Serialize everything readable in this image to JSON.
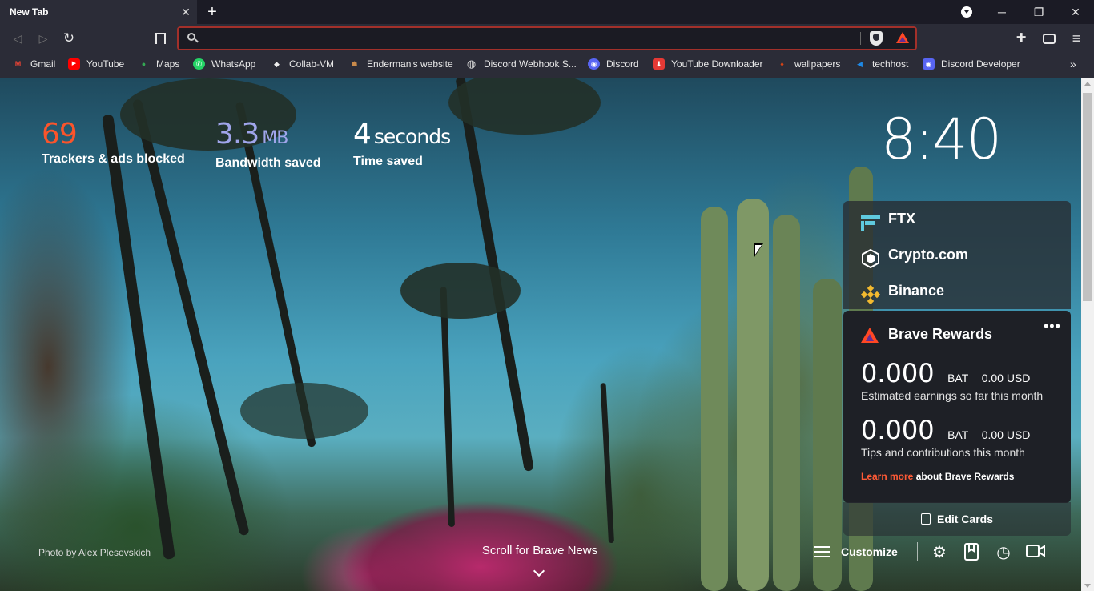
{
  "tab": {
    "title": "New Tab",
    "close_glyph": "✕",
    "new_tab_glyph": "+"
  },
  "window_controls": {
    "minimize": "─",
    "restore": "❐",
    "close": "✕"
  },
  "toolbar": {
    "back_glyph": "◁",
    "forward_glyph": "▷",
    "reload_glyph": "↻",
    "omnibox_value": "",
    "extensions_glyph": "✚",
    "menu_glyph": "≡"
  },
  "bookmarks": [
    {
      "label": "Gmail",
      "icon": "gmail-icon",
      "color": "#ea4335",
      "glyph": "M"
    },
    {
      "label": "YouTube",
      "icon": "youtube-icon",
      "color": "#ff0000",
      "glyph": "▶"
    },
    {
      "label": "Maps",
      "icon": "maps-icon",
      "color": "#34a853",
      "glyph": "●"
    },
    {
      "label": "WhatsApp",
      "icon": "whatsapp-icon",
      "color": "#25d366",
      "glyph": "✆"
    },
    {
      "label": "Collab-VM",
      "icon": "collab-vm-icon",
      "color": "#555555",
      "glyph": "◆"
    },
    {
      "label": "Enderman's website",
      "icon": "enderman-icon",
      "color": "#8a5a2b",
      "glyph": "☗"
    },
    {
      "label": "Discord Webhook S...",
      "icon": "globe-icon",
      "color": "#dddddd",
      "glyph": "◍"
    },
    {
      "label": "Discord",
      "icon": "discord-icon",
      "color": "#5865f2",
      "glyph": "◉"
    },
    {
      "label": "YouTube Downloader",
      "icon": "download-icon",
      "color": "#e53935",
      "glyph": "⬇"
    },
    {
      "label": "wallpapers",
      "icon": "wallpapers-icon",
      "color": "#d84315",
      "glyph": "♦"
    },
    {
      "label": "techhost",
      "icon": "techhost-icon",
      "color": "#1e88e5",
      "glyph": "◀"
    },
    {
      "label": "Discord Developer",
      "icon": "discord-developer-icon",
      "color": "#5865f2",
      "glyph": "◉"
    }
  ],
  "bookmarks_more": "»",
  "stats": {
    "trackers": {
      "value": "69",
      "label": "Trackers & ads blocked",
      "color": "#fb542b"
    },
    "bandwidth": {
      "value": "3.3",
      "unit": "MB",
      "label": "Bandwidth saved",
      "color": "#a0a5eb"
    },
    "time": {
      "value": "4",
      "unit": "seconds",
      "label": "Time saved",
      "color": "#ffffff"
    }
  },
  "clock": "8:40",
  "widgets": {
    "tabs": [
      {
        "label": "FTX",
        "icon": "ftx-icon"
      },
      {
        "label": "Crypto.com",
        "icon": "crypto-com-icon"
      },
      {
        "label": "Binance",
        "icon": "binance-icon"
      }
    ],
    "rewards": {
      "title": "Brave Rewards",
      "more": "•••",
      "earnings": {
        "amount": "0.000",
        "currency": "BAT",
        "usd": "0.00 USD",
        "desc": "Estimated earnings so far this month"
      },
      "tips": {
        "amount": "0.000",
        "currency": "BAT",
        "usd": "0.00 USD",
        "desc": "Tips and contributions this month"
      },
      "learn_more": "Learn more",
      "learn_more_rest": "about Brave Rewards"
    },
    "edit_cards": "Edit Cards"
  },
  "footer": {
    "photo_credit": "Photo by Alex Plesovskich",
    "brave_news": "Scroll for Brave News",
    "customize": "Customize",
    "settings_glyph": "⚙",
    "history_glyph": "◷"
  }
}
